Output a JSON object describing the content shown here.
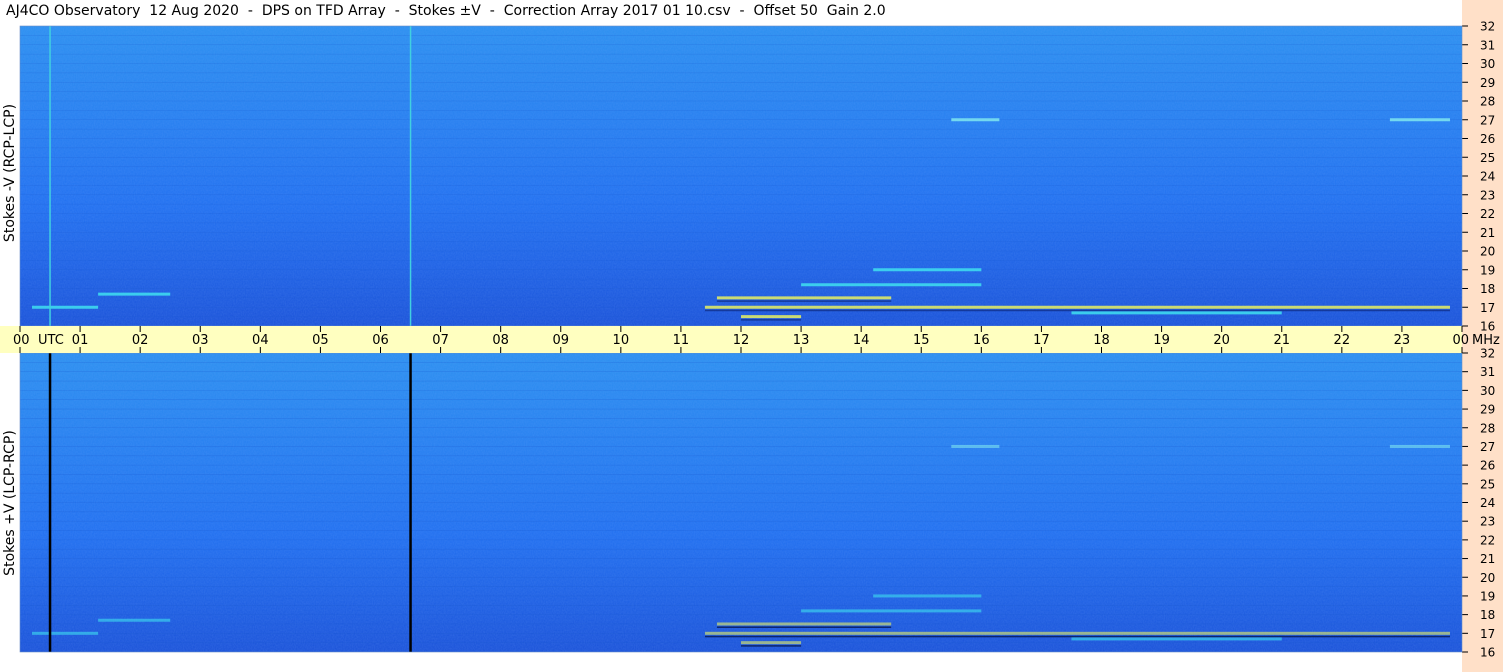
{
  "title": "AJ4CO Observatory  12 Aug 2020  -  DPS on TFD Array  -  Stokes ±V  -  Correction Array 2017 01 10.csv  -  Offset 50  Gain 2.0",
  "colors": {
    "background": "#ffffff",
    "time_axis_band": "#ffffc0",
    "freq_axis_band": "#ffe0c8",
    "spectrogram_base": "#1f6ff0",
    "spectrogram_deep": "#1850d8",
    "spectrogram_light": "#2a90f0",
    "burst_cyan": "#40e0f0",
    "burst_yellow": "#e8f060",
    "marker_top": "#40d0e0",
    "marker_bottom": "#000000"
  },
  "chart_data": {
    "type": "heatmap",
    "x_axis": {
      "label": "UTC",
      "range_hours": [
        0,
        24
      ],
      "tick_labels": [
        "00",
        "01",
        "02",
        "03",
        "04",
        "05",
        "06",
        "07",
        "08",
        "09",
        "10",
        "11",
        "12",
        "13",
        "14",
        "15",
        "16",
        "17",
        "18",
        "19",
        "20",
        "21",
        "22",
        "23",
        "00"
      ],
      "first_tick_suffix": "UTC",
      "last_tick_suffix": "MHz"
    },
    "y_axis": {
      "unit": "MHz",
      "range": [
        16,
        32
      ],
      "tick_labels": [
        "32",
        "31",
        "30",
        "29",
        "28",
        "27",
        "26",
        "25",
        "24",
        "23",
        "22",
        "21",
        "20",
        "19",
        "18",
        "17",
        "16"
      ]
    },
    "panels": [
      {
        "label": "Stokes -V (RCP-LCP)",
        "marker_color": "marker_top"
      },
      {
        "label": "Stokes +V (LCP-RCP)",
        "marker_color": "marker_bottom"
      }
    ],
    "vertical_markers_utc": [
      0.5,
      6.5
    ],
    "bursts": [
      {
        "t0": 11.4,
        "t1": 23.8,
        "f": 17.0,
        "kind": "strong"
      },
      {
        "t0": 11.6,
        "t1": 14.5,
        "f": 17.5,
        "kind": "strong"
      },
      {
        "t0": 13.0,
        "t1": 16.0,
        "f": 18.2,
        "kind": "medium"
      },
      {
        "t0": 14.2,
        "t1": 16.0,
        "f": 19.0,
        "kind": "medium"
      },
      {
        "t0": 12.0,
        "t1": 13.0,
        "f": 16.5,
        "kind": "strong"
      },
      {
        "t0": 1.3,
        "t1": 2.5,
        "f": 17.7,
        "kind": "medium"
      },
      {
        "t0": 0.2,
        "t1": 1.3,
        "f": 17.0,
        "kind": "medium"
      },
      {
        "t0": 15.5,
        "t1": 16.3,
        "f": 27.0,
        "kind": "weak"
      },
      {
        "t0": 22.8,
        "t1": 23.8,
        "f": 27.0,
        "kind": "weak"
      },
      {
        "t0": 17.5,
        "t1": 21.0,
        "f": 16.7,
        "kind": "medium"
      }
    ]
  }
}
